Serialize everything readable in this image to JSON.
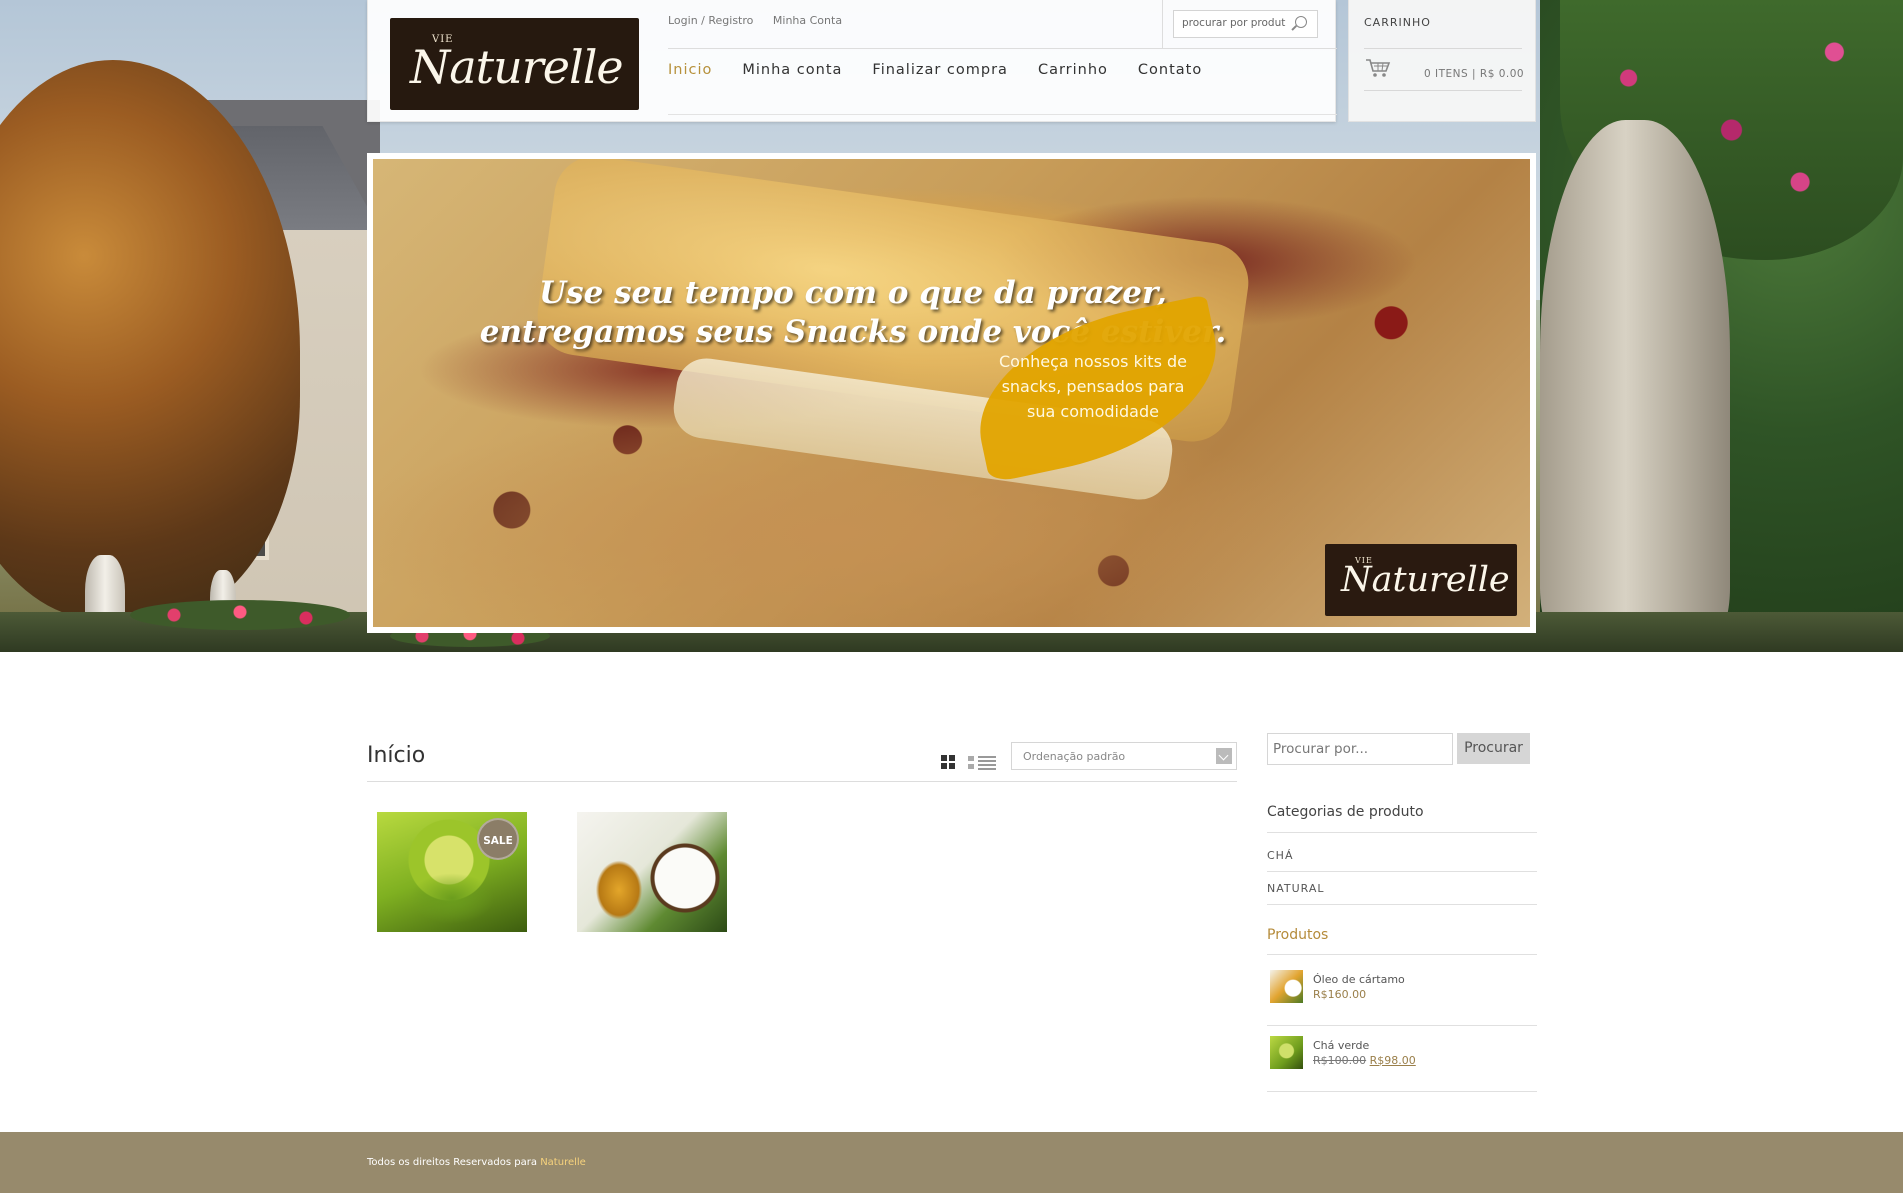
{
  "header": {
    "logo_small": "VIE",
    "logo_text": "Naturelle",
    "top_links": [
      "Login / Registro",
      "Minha Conta"
    ],
    "search_placeholder": "procurar por produt",
    "nav": [
      {
        "label": "Inicio",
        "active": true
      },
      {
        "label": "Minha conta",
        "active": false
      },
      {
        "label": "Finalizar compra",
        "active": false
      },
      {
        "label": "Carrinho",
        "active": false
      },
      {
        "label": "Contato",
        "active": false
      }
    ]
  },
  "cart": {
    "title": "CARRINHO",
    "icon": "cart-icon",
    "total": "0 ITENS | R$ 0.00"
  },
  "banner": {
    "headline_line1": "Use seu tempo com o que da prazer,",
    "headline_line2": "entregamos seus Snacks onde você estiver.",
    "leaf_text": "Conheça nossos kits de snacks, pensados para sua comodidade",
    "logo_small": "VIE",
    "logo_text": "Naturelle"
  },
  "main": {
    "title": "Início",
    "view_icons": [
      "grid-view-icon",
      "list-view-icon"
    ],
    "sort_selected": "Ordenação padrão",
    "products": [
      {
        "name": "Chá verde",
        "badge": "SALE"
      },
      {
        "name": "Óleo de cártamo",
        "badge": ""
      }
    ]
  },
  "sidebar": {
    "search_placeholder": "Procurar por...",
    "search_button": "Procurar",
    "categories_title": "Categorias de produto",
    "categories": [
      "CHÁ",
      "NATURAL"
    ],
    "products_title": "Produtos",
    "products": [
      {
        "name": "Óleo de cártamo",
        "price": "R$160.00",
        "old_price": ""
      },
      {
        "name": "Chá verde",
        "price": "R$98.00",
        "old_price": "R$100.00"
      }
    ]
  },
  "footer": {
    "text": "Todos os direitos Reservados para",
    "brand": "Naturelle"
  },
  "colors": {
    "accent_gold": "#b7913c",
    "footer_bg": "#978a6c",
    "logo_bg": "#26190f"
  }
}
